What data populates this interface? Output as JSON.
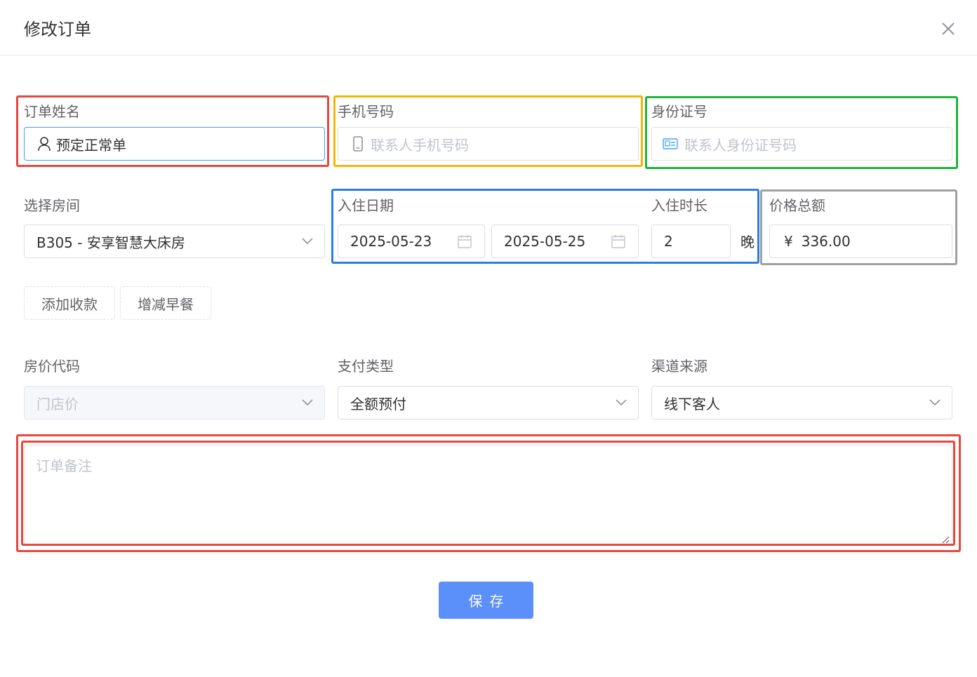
{
  "dialog": {
    "title": "修改订单",
    "close_icon": "close-icon"
  },
  "order_name": {
    "label": "订单姓名",
    "value": "预定正常单",
    "icon": "user-icon"
  },
  "phone": {
    "label": "手机号码",
    "placeholder": "联系人手机号码",
    "icon": "mobile-icon"
  },
  "id_card": {
    "label": "身份证号",
    "placeholder": "联系人身份证号码",
    "icon": "id-card-icon"
  },
  "room": {
    "label": "选择房间",
    "value": "B305 - 安享智慧大床房"
  },
  "check_in": {
    "label": "入住日期",
    "start": "2025-05-23",
    "end": "2025-05-25"
  },
  "duration": {
    "label": "入住时长",
    "value": "2",
    "unit": "晚"
  },
  "price": {
    "label": "价格总额",
    "symbol": "¥",
    "value": "336.00"
  },
  "actions": {
    "add_payment": "添加收款",
    "adjust_breakfast": "增减早餐"
  },
  "rate_code": {
    "label": "房价代码",
    "value": "门店价"
  },
  "payment_type": {
    "label": "支付类型",
    "value": "全额预付"
  },
  "channel": {
    "label": "渠道来源",
    "value": "线下客人"
  },
  "remark": {
    "placeholder": "订单备注"
  },
  "save_label": "保存",
  "colors": {
    "primary": "#5b8ff9",
    "highlight_red": "#e8473e",
    "highlight_yellow": "#f2b705",
    "highlight_green": "#1fb53a",
    "highlight_blue": "#2b7ce9",
    "highlight_gray": "#a0a0a0"
  }
}
